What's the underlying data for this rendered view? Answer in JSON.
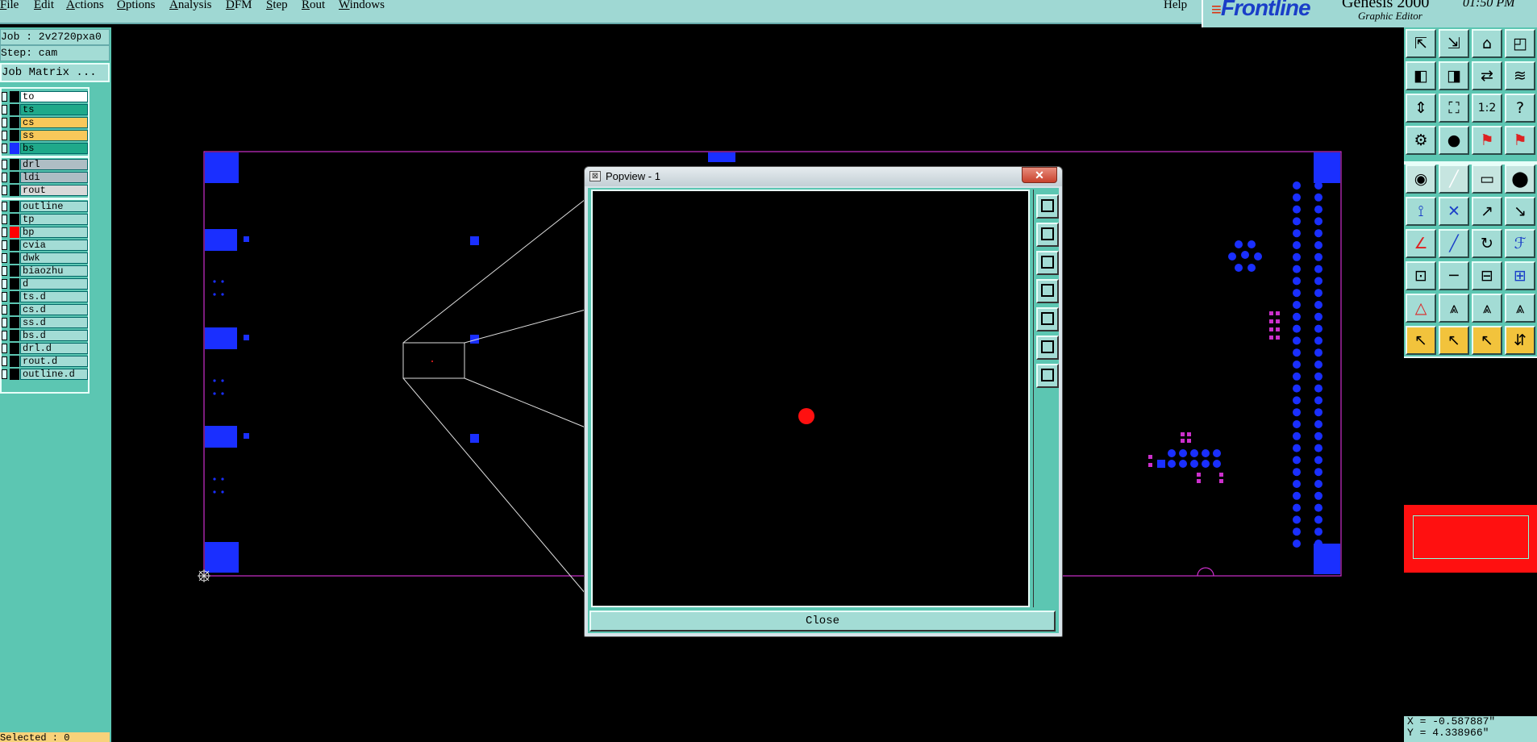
{
  "menubar": {
    "items": [
      "File",
      "Edit",
      "Actions",
      "Options",
      "Analysis",
      "DFM",
      "Step",
      "Rout",
      "Windows"
    ],
    "help": "Help"
  },
  "brand": {
    "logo": "Frontline",
    "product": "Genesis 2000",
    "subtitle": "Graphic Editor",
    "time": "01:50 PM"
  },
  "job": {
    "job_line": "Job : 2v2720pxa0",
    "step_line": "Step: cam",
    "matrix_button": "Job Matrix ..."
  },
  "layers": [
    {
      "name": "to",
      "color": "#ffffff",
      "swatch": "#000000"
    },
    {
      "name": "ts",
      "color": "#1fa98a",
      "swatch": "#000000"
    },
    {
      "name": "cs",
      "color": "#f8c85a",
      "swatch": "#000000"
    },
    {
      "name": "ss",
      "color": "#f8c85a",
      "swatch": "#000000"
    },
    {
      "name": "bs",
      "color": "#1fa98a",
      "swatch": "#1a2fff"
    },
    {
      "name": "drl",
      "color": "#aebdc4",
      "swatch": "#000000"
    },
    {
      "name": "ldi",
      "color": "#aebdc4",
      "swatch": "#000000"
    },
    {
      "name": "rout",
      "color": "#d9d9d9",
      "swatch": "#000000"
    },
    {
      "name": "outline",
      "color": "#a3dcd5",
      "swatch": "#000000"
    },
    {
      "name": "tp",
      "color": "#a3dcd5",
      "swatch": "#000000"
    },
    {
      "name": "bp",
      "color": "#a3dcd5",
      "swatch": "#ff0000"
    },
    {
      "name": "cvia",
      "color": "#a3dcd5",
      "swatch": "#000000"
    },
    {
      "name": "dwk",
      "color": "#a3dcd5",
      "swatch": "#000000"
    },
    {
      "name": "biaozhu",
      "color": "#a3dcd5",
      "swatch": "#000000"
    },
    {
      "name": "d",
      "color": "#a3dcd5",
      "swatch": "#000000"
    },
    {
      "name": "ts.d",
      "color": "#a3dcd5",
      "swatch": "#000000"
    },
    {
      "name": "cs.d",
      "color": "#a3dcd5",
      "swatch": "#000000"
    },
    {
      "name": "ss.d",
      "color": "#a3dcd5",
      "swatch": "#000000"
    },
    {
      "name": "bs.d",
      "color": "#a3dcd5",
      "swatch": "#000000"
    },
    {
      "name": "drl.d",
      "color": "#a3dcd5",
      "swatch": "#000000"
    },
    {
      "name": "rout.d",
      "color": "#a3dcd5",
      "swatch": "#000000"
    },
    {
      "name": "outline.d",
      "color": "#a3dcd5",
      "swatch": "#000000"
    }
  ],
  "status": {
    "selected": "Selected : 0"
  },
  "popview": {
    "title": "Popview - 1",
    "close_button": "Close",
    "close_x": "✕",
    "tools": [
      "zoom-window-icon",
      "zoom-in-icon",
      "zoom-out-icon",
      "pan-left-icon",
      "pan-right-icon",
      "fit-all-icon",
      "zoom-home-icon"
    ]
  },
  "toolbar": {
    "tools": [
      "zoom-home-icon",
      "zoom-in-icon",
      "home-icon",
      "window-icon",
      "pan-left-icon",
      "pan-right-icon",
      "swap-icon",
      "snap-icon",
      "fit-height-icon",
      "fit-all-icon",
      "ratio-icon",
      "help-icon",
      "measure-icon",
      "pin-icon",
      "layer-red-icon",
      "layer-red2-icon",
      "pad-icon",
      "line-icon",
      "ruler-icon",
      "circle-icon",
      "net-icon",
      "delete-icon",
      "move-icon",
      "copy-icon",
      "angle-icon",
      "slash-icon",
      "arc-icon",
      "text-icon",
      "resize-icon",
      "minus-icon",
      "split-icon",
      "group-icon",
      "triangle-icon",
      "peak-icon",
      "peak2-icon",
      "peak3-icon",
      "select-icon",
      "select-box-icon",
      "select-cursor-icon",
      "select-multi-icon"
    ],
    "ratio_label": "1:2",
    "help_label": "?"
  },
  "coordinates": {
    "x": "X = -0.587887\"",
    "y": "Y = 4.338966\""
  },
  "colors": {
    "accent": "#5cc6b2",
    "pad_blue": "#1a2fff",
    "magenta": "#cc2fcc",
    "highlight_red": "#ff1010"
  }
}
